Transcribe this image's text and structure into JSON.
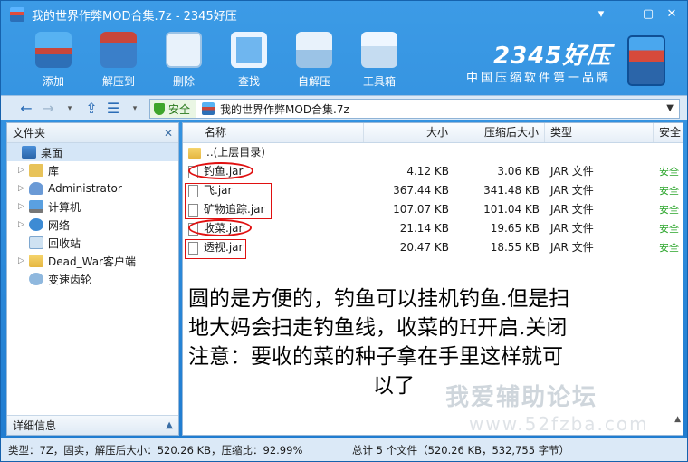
{
  "window": {
    "title": "我的世界作弊MOD合集.7z - 2345好压"
  },
  "toolbar": {
    "items": [
      {
        "label": "添加",
        "icon": "add-archive-icon"
      },
      {
        "label": "解压到",
        "icon": "extract-icon"
      },
      {
        "label": "删除",
        "icon": "delete-icon"
      },
      {
        "label": "查找",
        "icon": "search-icon"
      },
      {
        "label": "自解压",
        "icon": "sfx-icon"
      },
      {
        "label": "工具箱",
        "icon": "toolbox-icon"
      }
    ],
    "brand": {
      "name": "2345好压",
      "slogan": "中国压缩软件第一品牌"
    }
  },
  "address": {
    "safe_label": "安全",
    "path": "我的世界作弊MOD合集.7z"
  },
  "left_panel": {
    "header": "文件夹",
    "tree": [
      {
        "label": "桌面",
        "icon": "desktop-icon",
        "selected": true
      },
      {
        "label": "库",
        "icon": "library-icon"
      },
      {
        "label": "Administrator",
        "icon": "user-folder-icon"
      },
      {
        "label": "计算机",
        "icon": "computer-icon"
      },
      {
        "label": "网络",
        "icon": "network-icon"
      },
      {
        "label": "回收站",
        "icon": "recycle-bin-icon"
      },
      {
        "label": "Dead_War客户端",
        "icon": "folder-icon"
      },
      {
        "label": "变速齿轮",
        "icon": "gear-app-icon"
      }
    ],
    "footer": "详细信息"
  },
  "file_list": {
    "columns": {
      "name": "名称",
      "size": "大小",
      "compressed": "压缩后大小",
      "type": "类型",
      "safety": "安全"
    },
    "rows": [
      {
        "name": "..(上层目录)",
        "size": "",
        "compressed": "",
        "type": "",
        "safety": ""
      },
      {
        "name": "钓鱼.jar",
        "size": "4.12 KB",
        "compressed": "3.06 KB",
        "type": "JAR 文件",
        "safety": "安全"
      },
      {
        "name": "飞.jar",
        "size": "367.44 KB",
        "compressed": "341.48 KB",
        "type": "JAR 文件",
        "safety": "安全"
      },
      {
        "name": "矿物追踪.jar",
        "size": "107.07 KB",
        "compressed": "101.04 KB",
        "type": "JAR 文件",
        "safety": "安全"
      },
      {
        "name": "收菜.jar",
        "size": "21.14 KB",
        "compressed": "19.65 KB",
        "type": "JAR 文件",
        "safety": "安全"
      },
      {
        "name": "透视.jar",
        "size": "20.47 KB",
        "compressed": "18.55 KB",
        "type": "JAR 文件",
        "safety": "安全"
      }
    ]
  },
  "annotation": {
    "lines": [
      "圆的是方便的，钓鱼可以挂机钓鱼.但是扫",
      "地大妈会扫走钓鱼线，收菜的H开启.关闭",
      "注意：要收的菜的种子拿在手里这样就可",
      "以了"
    ]
  },
  "watermark": {
    "text": "我爱辅助论坛",
    "url": "www.52fzba.com"
  },
  "statusbar": {
    "left": "类型：7Z，固实，解压后大小：520.26 KB，压缩比：92.99%",
    "right": "总计 5 个文件（520.26 KB，532,755 字节）"
  }
}
